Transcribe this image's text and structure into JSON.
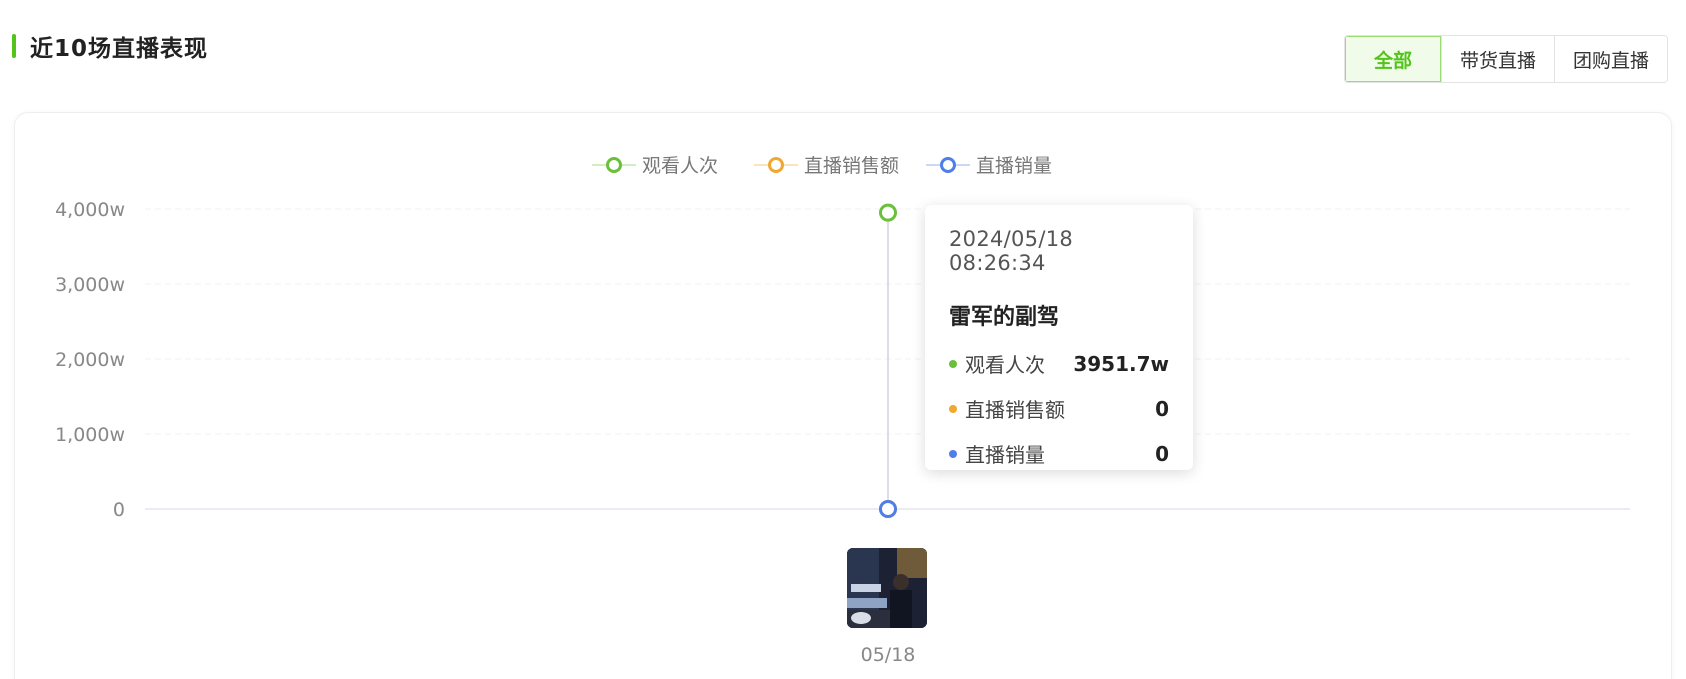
{
  "section": {
    "title": "近10场直播表现"
  },
  "tabs": [
    {
      "label": "全部",
      "active": true
    },
    {
      "label": "带货直播",
      "active": false
    },
    {
      "label": "团购直播",
      "active": false
    }
  ],
  "chart_data": {
    "type": "line",
    "categories": [
      "05/18"
    ],
    "series": [
      {
        "name": "观看人次",
        "color": "#6abf3b",
        "values": [
          3951.7
        ]
      },
      {
        "name": "直播销售额",
        "color": "#f0a830",
        "values": [
          0
        ]
      },
      {
        "name": "直播销量",
        "color": "#4f7ee8",
        "values": [
          0
        ]
      }
    ],
    "ylim": [
      0,
      4000
    ],
    "yticks": [
      "0",
      "1,000w",
      "2,000w",
      "3,000w",
      "4,000w"
    ],
    "legend_position": "top-center",
    "grid": true
  },
  "tooltip": {
    "time": "2024/05/18 08:26:34",
    "name": "雷军的副驾",
    "rows": [
      {
        "label": "观看人次",
        "value": "3951.7w",
        "color": "#6abf3b"
      },
      {
        "label": "直播销售额",
        "value": "0",
        "color": "#f0a830"
      },
      {
        "label": "直播销量",
        "value": "0",
        "color": "#4f7ee8"
      }
    ]
  },
  "thumbnail": {
    "icon": "live-cover-thumbnail"
  }
}
